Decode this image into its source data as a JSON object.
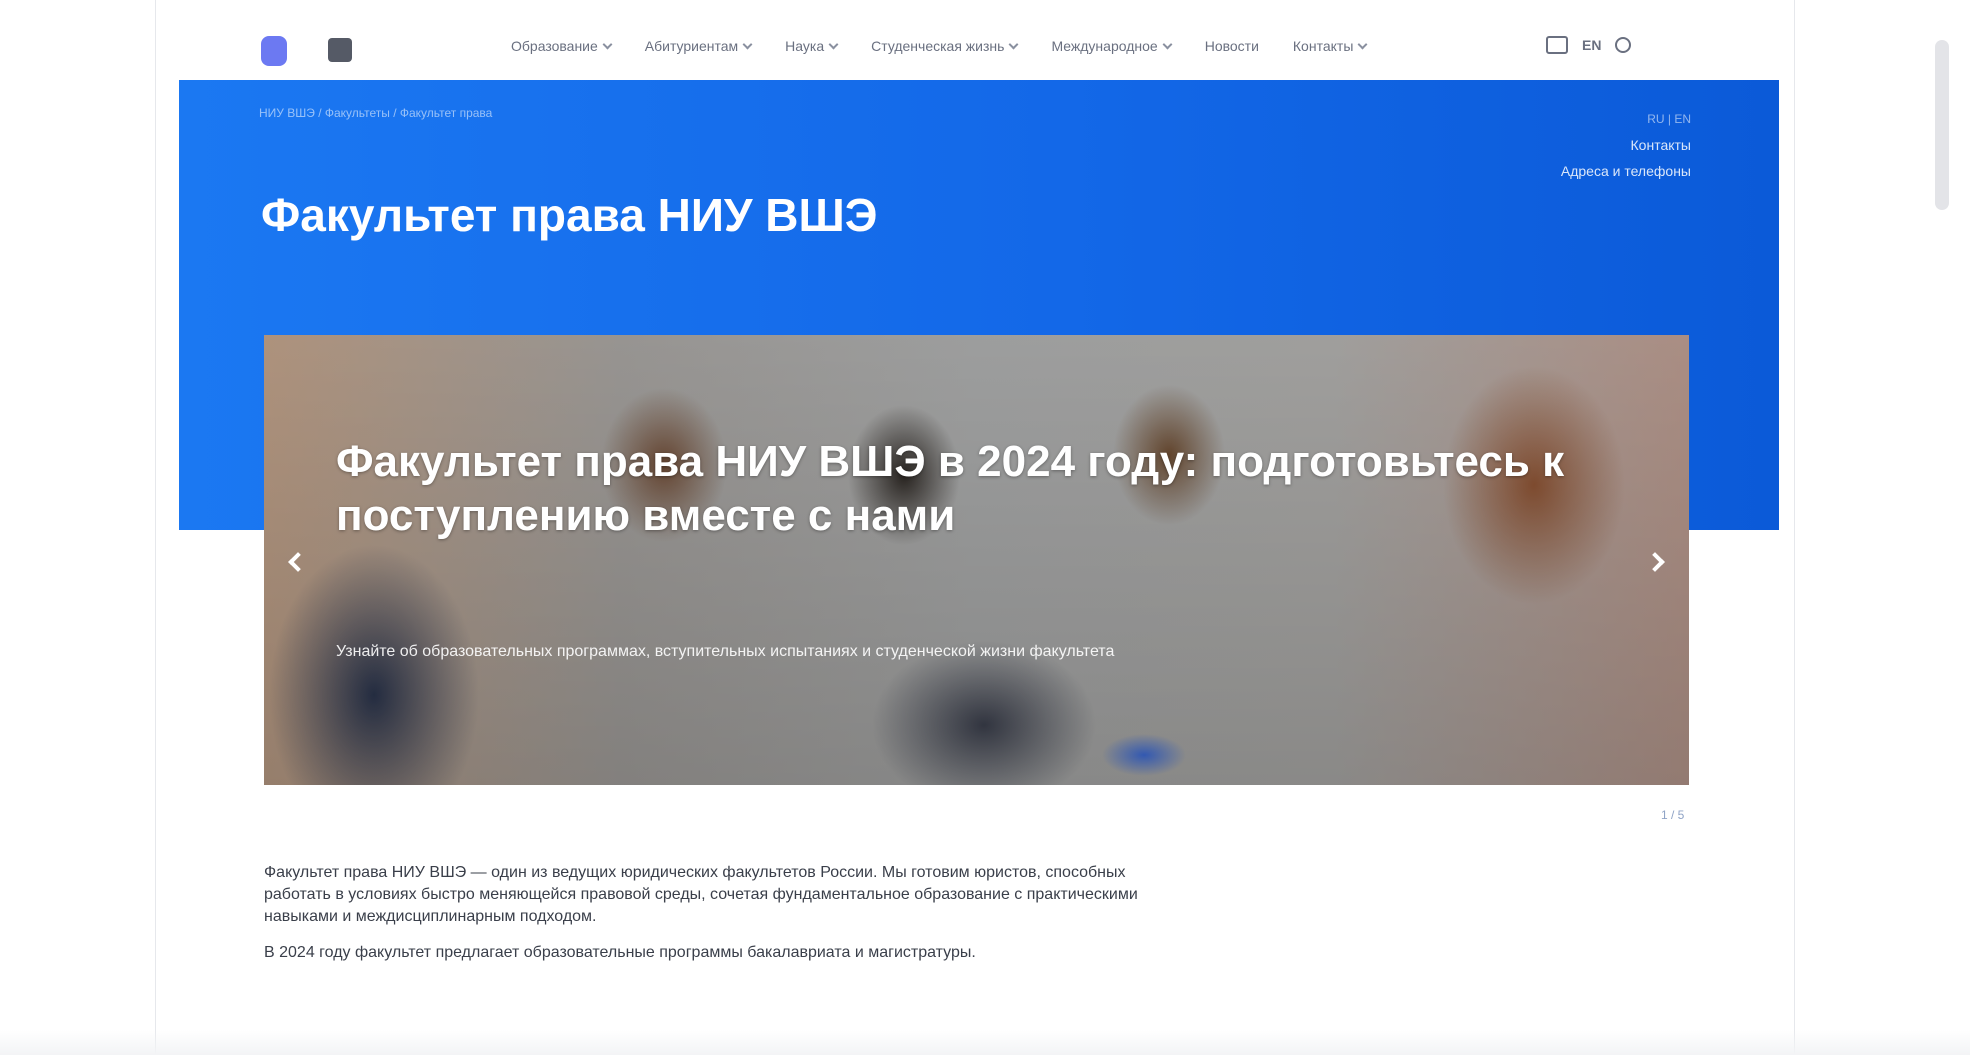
{
  "nav": {
    "items": [
      {
        "label": "Образование"
      },
      {
        "label": "Абитуриентам"
      },
      {
        "label": "Наука"
      },
      {
        "label": "Студенческая жизнь"
      },
      {
        "label": "Международное"
      },
      {
        "label": "Новости"
      },
      {
        "label": "Контакты"
      }
    ],
    "lang_label": "EN"
  },
  "hero": {
    "breadcrumb": "НИУ ВШЭ / Факультеты / Факультет права",
    "title": "Факультет права НИУ ВШЭ",
    "side_line1": "Контакты",
    "side_line2": "Адреса и телефоны",
    "side_small": "RU | EN"
  },
  "slider": {
    "headline": "Факультет права НИУ ВШЭ в 2024 году: подготовьтесь к поступлению вместе с нами",
    "caption": "Узнайте об образовательных программах, вступительных испытаниях и студенческой жизни факультета",
    "counter": "1 / 5"
  },
  "body": {
    "paragraph1": "Факультет права НИУ ВШЭ — один из ведущих юридических факультетов России. Мы готовим юристов, способных работать в условиях быстро меняющейся правовой среды, сочетая фундаментальное образование с практическими навыками и междисциплинарным подходом.",
    "paragraph2": "В 2024 году факультет предлагает образовательные программы бакалавриата и магистратуры."
  },
  "colors": {
    "hero_blue": "#1368e8",
    "logo_accent": "#6c79f2"
  }
}
